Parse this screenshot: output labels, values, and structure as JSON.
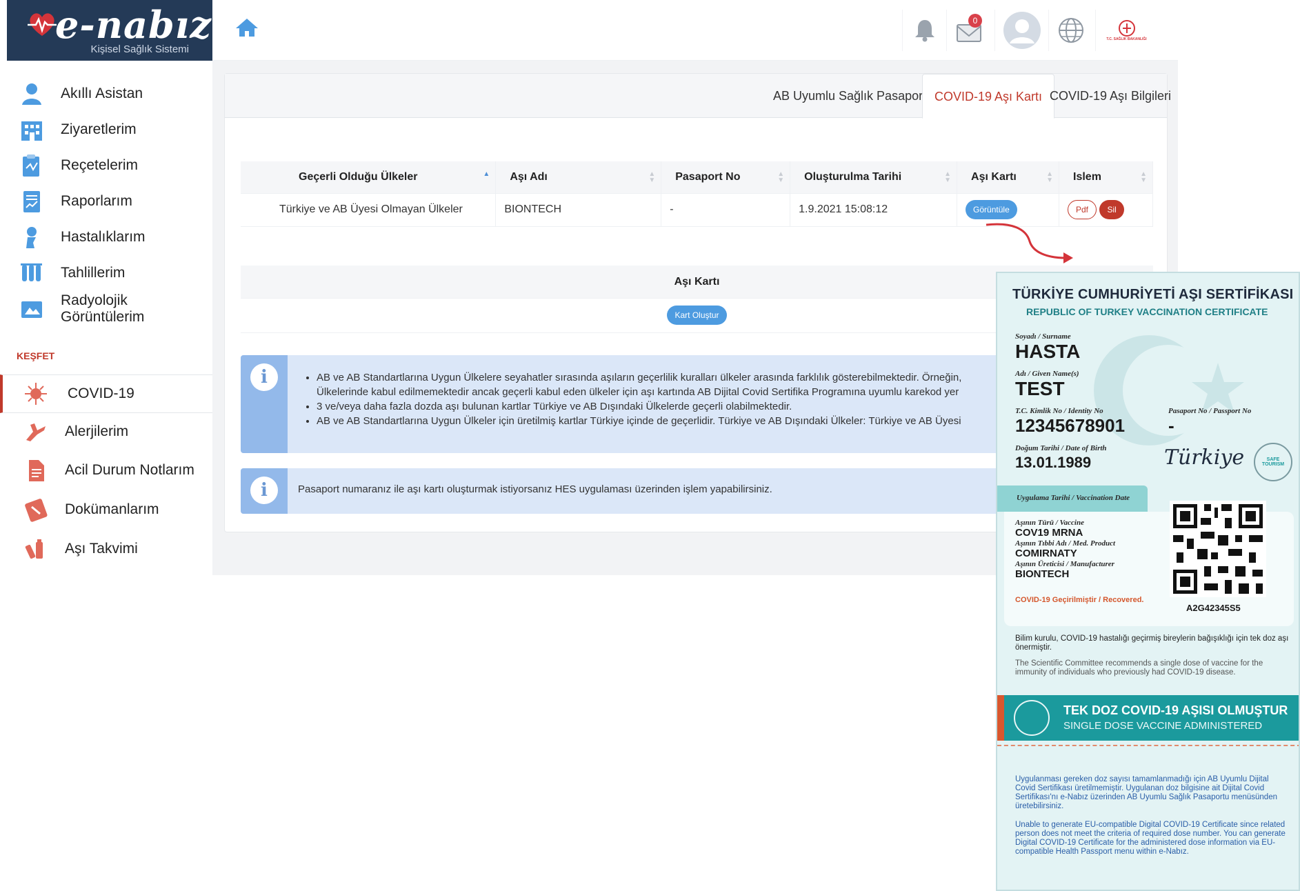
{
  "brand": {
    "name": "e-nabız",
    "subtitle": "Kişisel Sağlık Sistemi"
  },
  "header": {
    "mail_badge": "0",
    "ministry_logo_text": "T.C. SAĞLIK BAKANLIĞI"
  },
  "sidebar": {
    "items": [
      {
        "label": "Akıllı Asistan",
        "icon": "assistant-icon"
      },
      {
        "label": "Ziyaretlerim",
        "icon": "hospital-icon"
      },
      {
        "label": "Reçetelerim",
        "icon": "prescription-icon"
      },
      {
        "label": "Raporlarım",
        "icon": "report-icon"
      },
      {
        "label": "Hastalıklarım",
        "icon": "disease-icon"
      },
      {
        "label": "Tahlillerim",
        "icon": "test-tubes-icon"
      },
      {
        "label": "Radyolojik Görüntülerim",
        "icon": "radiology-icon"
      }
    ],
    "section_label": "KEŞFET",
    "explore": [
      {
        "label": "COVID-19",
        "icon": "virus-icon"
      },
      {
        "label": "Alerjilerim",
        "icon": "allergy-icon"
      },
      {
        "label": "Acil Durum Notlarım",
        "icon": "emergency-notes-icon"
      },
      {
        "label": "Dokümanlarım",
        "icon": "documents-icon"
      },
      {
        "label": "Aşı Takvimi",
        "icon": "vaccine-calendar-icon"
      }
    ]
  },
  "tabs": [
    {
      "label": "AB Uyumlu Sağlık Pasaportu"
    },
    {
      "label": "COVID-19 Aşı Kartı"
    },
    {
      "label": "COVID-19 Aşı Bilgileri"
    }
  ],
  "table": {
    "headers": [
      "Geçerli Olduğu Ülkeler",
      "Aşı Adı",
      "Pasaport No",
      "Oluşturulma Tarihi",
      "Aşı Kartı",
      "Islem"
    ],
    "rows": [
      {
        "countries": "Türkiye ve AB Üyesi Olmayan Ülkeler",
        "vaccine": "BIONTECH",
        "passport": "-",
        "created": "1.9.2021 15:08:12",
        "view_label": "Görüntüle",
        "pdf_label": "Pdf",
        "delete_label": "Sil"
      }
    ]
  },
  "card_section": {
    "title": "Aşı Kartı",
    "button": "Kart Oluştur"
  },
  "info": {
    "bullets": [
      "AB ve AB Standartlarına Uygun Ülkelere seyahatler sırasında aşıların geçerlilik kuralları ülkeler arasında farklılık gösterebilmektedir. Örneğin,",
      "Ülkelerinde kabul edilmemektedir ancak geçerli kabul eden ülkeler için aşı kartında AB Dijital Covid Sertifika Programına uyumlu karekod yer",
      "3 ve/veya daha fazla dozda aşı bulunan kartlar Türkiye ve AB Dışındaki Ülkelerde geçerli olabilmektedir.",
      "AB ve AB Standartlarına Uygun Ülkeler için üretilmiş kartlar Türkiye içinde de geçerlidir. Türkiye ve AB Dışındaki Ülkeler: Türkiye ve AB Üyesi"
    ],
    "passport_note": "Pasaport numaranız ile aşı kartı oluşturmak istiyorsanız HES uygulaması üzerinden işlem yapabilirsiniz."
  },
  "certificate": {
    "title": "TÜRKİYE CUMHURİYETİ AŞI SERTİFİKASI",
    "subtitle": "REPUBLIC OF TURKEY VACCINATION CERTIFICATE",
    "surname_label": "Soyadı / Surname",
    "surname": "HASTA",
    "name_label": "Adı / Given Name(s)",
    "name": "TEST",
    "id_label": "T.C. Kimlik No / Identity No",
    "id": "12345678901",
    "passport_label": "Pasaport No / Passport No",
    "passport": "-",
    "dob_label": "Doğum Tarihi / Date of Birth",
    "dob": "13.01.1989",
    "brand": "Türkiye",
    "safe_tourism": "SAFE TOURISM",
    "vac_date_label": "Uygulama Tarihi / Vaccination Date",
    "vaccine_label": "Aşının Türü / Vaccine",
    "vaccine": "COV19 MRNA",
    "product_label": "Aşının Tıbbi Adı / Med. Product",
    "product": "COMIRNATY",
    "manufacturer_label": "Aşının Üreticisi / Manufacturer",
    "manufacturer": "BIONTECH",
    "recovered": "COVID-19 Geçirilmiştir / Recovered.",
    "qr_code": "A2G42345S5",
    "committee_tr": "Bilim kurulu, COVID-19 hastalığı geçirmiş bireylerin bağışıklığı için tek doz aşı önermiştir.",
    "committee_en": "The Scientific Committee recommends a single dose of vaccine for the immunity of individuals who previously had COVID-19 disease.",
    "band_tr": "TEK DOZ COVID-19 AŞISI OLMUŞTUR",
    "band_en": "SINGLE DOSE VACCINE ADMINISTERED",
    "fine_tr": "Uygulanması gereken doz sayısı tamamlanmadığı için AB Uyumlu Dijital Covid Sertifikası üretilmemiştir. Uygulanan doz bilgisine ait Dijital Covid Sertifikası'nı e-Nabız üzerinden AB Uyumlu Sağlık Pasaportu menüsünden üretebilirsiniz.",
    "fine_en": "Unable to generate EU-compatible Digital COVID-19 Certificate since related person does not meet the criteria of required dose number. You can generate Digital COVID-19 Certificate for the administered dose information via EU-compatible Health Passport menu within e-Nabız."
  },
  "colors": {
    "brand_navy": "#243a57",
    "accent_red": "#c0392b",
    "accent_blue": "#4d9be0",
    "cert_teal": "#1b9a9d"
  }
}
